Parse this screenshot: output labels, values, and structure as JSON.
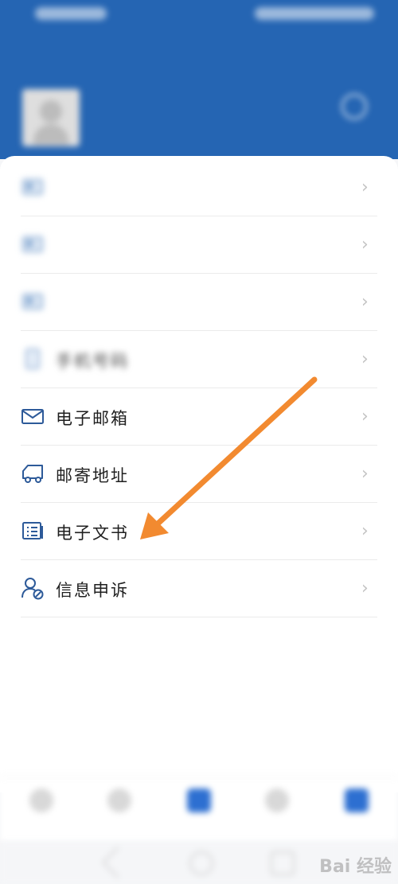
{
  "status_bar": {
    "left": "",
    "right": ""
  },
  "header": {
    "title": "",
    "user_name": "",
    "user_sub": "",
    "switch_label": ""
  },
  "rows": [
    {
      "label": "",
      "value": "",
      "icon": "id-card-icon",
      "blurred": true
    },
    {
      "label": "",
      "value": "",
      "icon": "id-card-icon",
      "blurred": true
    },
    {
      "label": "",
      "value": "",
      "icon": "id-card-icon",
      "blurred": true
    },
    {
      "label": "手机号码",
      "value": "",
      "icon": "phone-icon",
      "blurred": true
    },
    {
      "label": "电子邮箱",
      "value": "",
      "icon": "mail-icon",
      "blurred": false
    },
    {
      "label": "邮寄地址",
      "value": "",
      "icon": "truck-icon",
      "blurred": false
    },
    {
      "label": "电子文书",
      "value": "",
      "icon": "document-icon",
      "blurred": false
    },
    {
      "label": "信息申诉",
      "value": "",
      "icon": "user-appeal-icon",
      "blurred": false
    }
  ],
  "bottom_nav": [
    {
      "label": "",
      "icon": "home-icon"
    },
    {
      "label": "",
      "icon": "service-icon"
    },
    {
      "label": "",
      "icon": "center-icon",
      "active": true
    },
    {
      "label": "",
      "icon": "hall-icon"
    },
    {
      "label": "",
      "icon": "profile-icon"
    }
  ],
  "watermark": "Bai 经验",
  "colors": {
    "header_blue": "#2565b3",
    "icon_blue": "#2d5a99",
    "arrow_orange": "#f28a30"
  }
}
